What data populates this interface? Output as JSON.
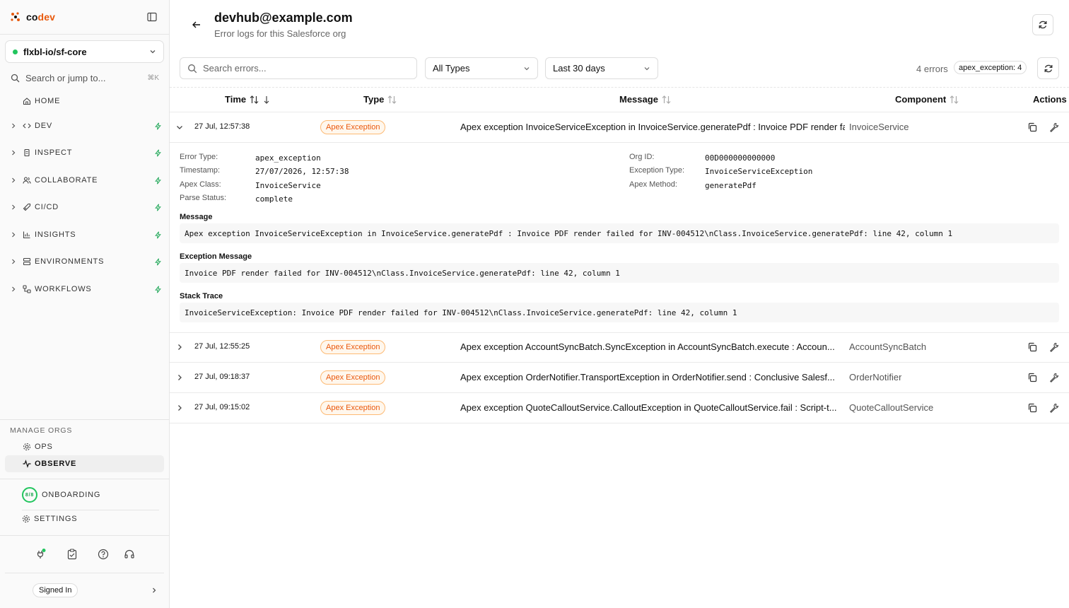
{
  "brand": {
    "name_prefix": "co",
    "name_suffix": "dev"
  },
  "sidebar": {
    "org": "flxbl-io/sf-core",
    "search_placeholder": "Search or jump to...",
    "search_shortcut": "⌘K",
    "home": "HOME",
    "sections": [
      {
        "label": "DEV",
        "icon": "code-icon"
      },
      {
        "label": "INSPECT",
        "icon": "file-icon"
      },
      {
        "label": "COLLABORATE",
        "icon": "users-icon"
      },
      {
        "label": "CI/CD",
        "icon": "rocket-icon"
      },
      {
        "label": "INSIGHTS",
        "icon": "bar-chart-icon"
      },
      {
        "label": "ENVIRONMENTS",
        "icon": "server-icon"
      },
      {
        "label": "WORKFLOWS",
        "icon": "workflow-icon"
      }
    ],
    "manage_label": "MANAGE ORGS",
    "ops": "OPS",
    "observe": "OBSERVE",
    "onboarding": "ONBOARDING",
    "onboarding_progress": "8/8",
    "settings": "SETTINGS",
    "signed_in": "Signed In"
  },
  "header": {
    "title": "devhub@example.com",
    "subtitle": "Error logs for this Salesforce org"
  },
  "filters": {
    "search_placeholder": "Search errors...",
    "type": "All Types",
    "range": "Last 30 days",
    "count": "4 errors",
    "badge": "apex_exception: 4"
  },
  "table": {
    "headers": {
      "time": "Time",
      "type": "Type",
      "message": "Message",
      "component": "Component",
      "actions": "Actions"
    },
    "rows": [
      {
        "time": "27 Jul, 12:57:38",
        "type": "Apex Exception",
        "message": "Apex exception InvoiceServiceException in InvoiceService.generatePdf : Invoice PDF render failed for INV-004512",
        "component": "InvoiceService"
      },
      {
        "time": "27 Jul, 12:55:25",
        "type": "Apex Exception",
        "message": "Apex exception AccountSyncBatch.SyncException in AccountSyncBatch.execute : Accoun...",
        "component": "AccountSyncBatch"
      },
      {
        "time": "27 Jul, 09:18:37",
        "type": "Apex Exception",
        "message": "Apex exception OrderNotifier.TransportException in OrderNotifier.send : Conclusive Salesf...",
        "component": "OrderNotifier"
      },
      {
        "time": "27 Jul, 09:15:02",
        "type": "Apex Exception",
        "message": "Apex exception QuoteCalloutService.CalloutException in QuoteCalloutService.fail : Script-t...",
        "component": "QuoteCalloutService"
      }
    ]
  },
  "detail": {
    "left": [
      {
        "label": "Error Type:",
        "value": "apex_exception"
      },
      {
        "label": "Timestamp:",
        "value": "27/07/2026, 12:57:38"
      },
      {
        "label": "Apex Class:",
        "value": "InvoiceService"
      },
      {
        "label": "Parse Status:",
        "value": "complete"
      }
    ],
    "right": [
      {
        "label": "Org ID:",
        "value": "00D000000000000"
      },
      {
        "label": "Exception Type:",
        "value": "InvoiceServiceException"
      },
      {
        "label": "Apex Method:",
        "value": "generatePdf"
      }
    ],
    "message_label": "Message",
    "message": "Apex exception InvoiceServiceException in InvoiceService.generatePdf : Invoice PDF render failed for INV-004512\\nClass.InvoiceService.generatePdf: line 42, column 1",
    "exception_label": "Exception Message",
    "exception": "Invoice PDF render failed for INV-004512\\nClass.InvoiceService.generatePdf: line 42, column 1",
    "stack_label": "Stack Trace",
    "stack": "InvoiceServiceException: Invoice PDF render failed for INV-004512\\nClass.InvoiceService.generatePdf: line 42, column 1"
  },
  "colors": {
    "accent": "#e8590c",
    "status_ok": "#22c55e",
    "badge_text": "#ea580c"
  }
}
